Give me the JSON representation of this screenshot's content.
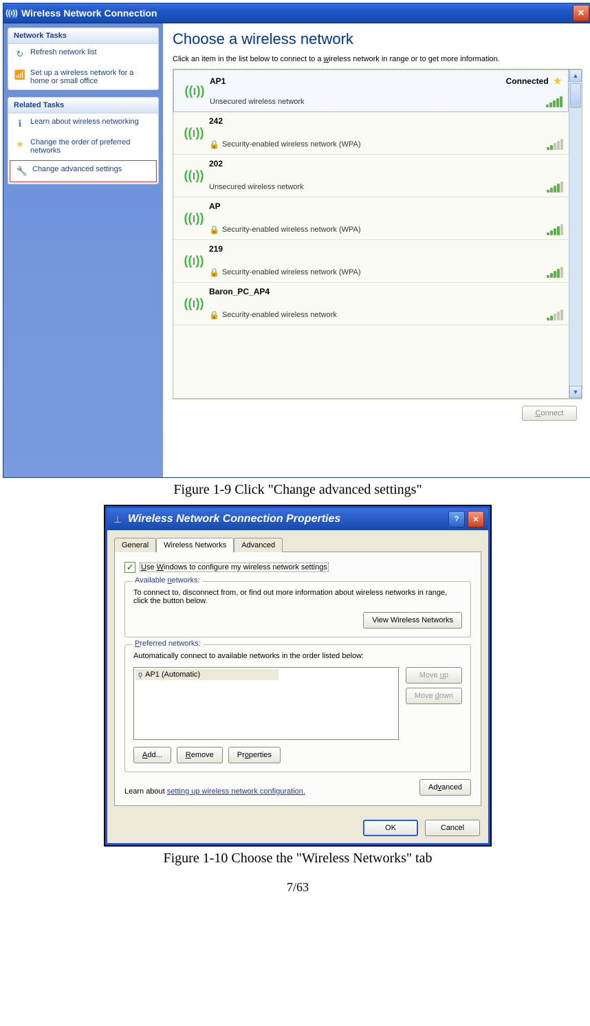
{
  "win1": {
    "title": "Wireless Network Connection",
    "sidebar": {
      "sections": [
        {
          "header": "Network Tasks",
          "items": [
            {
              "icon": "↻",
              "label": "Refresh network list"
            },
            {
              "icon": "📶",
              "label": "Set up a wireless network for a home or small office"
            }
          ]
        },
        {
          "header": "Related Tasks",
          "items": [
            {
              "icon": "ℹ",
              "label": "Learn about wireless networking"
            },
            {
              "icon": "★",
              "label": "Change the order of preferred networks"
            },
            {
              "icon": "🔧",
              "label": "Change advanced settings",
              "highlight": true
            }
          ]
        }
      ]
    },
    "content": {
      "title": "Choose a wireless network",
      "desc_prefix": "Click an item in the list below to connect to a ",
      "desc_u": "w",
      "desc_suffix": "ireless network in range or to get more information.",
      "networks": [
        {
          "name": "AP1",
          "type": "Unsecured wireless network",
          "secure": false,
          "signal": 5,
          "status": "Connected",
          "star": true,
          "selected": true
        },
        {
          "name": "242",
          "type": "Security-enabled wireless network (WPA)",
          "secure": true,
          "signal": 2
        },
        {
          "name": "202",
          "type": "Unsecured wireless network",
          "secure": false,
          "signal": 4
        },
        {
          "name": "AP",
          "type": "Security-enabled wireless network (WPA)",
          "secure": true,
          "signal": 4
        },
        {
          "name": "219",
          "type": "Security-enabled wireless network (WPA)",
          "secure": true,
          "signal": 4
        },
        {
          "name": "Baron_PC_AP4",
          "type": "Security-enabled wireless network",
          "secure": true,
          "signal": 2
        }
      ],
      "connect_label": "Connect"
    }
  },
  "caption1": "Figure 1-9 Click \"Change advanced settings\"",
  "win2": {
    "title": "Wireless Network Connection Properties",
    "tabs": {
      "general": "General",
      "wireless": "Wireless Networks",
      "advanced": "Advanced"
    },
    "checkbox_label": "Use Windows to configure my wireless network settings",
    "available": {
      "legend": "Available networks:",
      "text": "To connect to, disconnect from, or find out more information about wireless networks in range, click the button below.",
      "button": "View Wireless Networks"
    },
    "preferred": {
      "legend": "Preferred networks:",
      "text": "Automatically connect to available networks in the order listed below:",
      "item": "AP1 (Automatic)",
      "moveup": "Move up",
      "movedown": "Move down",
      "add": "Add...",
      "remove": "Remove",
      "properties": "Properties"
    },
    "learn_prefix": "Learn about ",
    "learn_link": "setting up wireless network configuration.",
    "advanced_btn": "Advanced",
    "ok": "OK",
    "cancel": "Cancel"
  },
  "caption2": "Figure 1-10 Choose the \"Wireless Networks\" tab",
  "page_num": "7/63"
}
